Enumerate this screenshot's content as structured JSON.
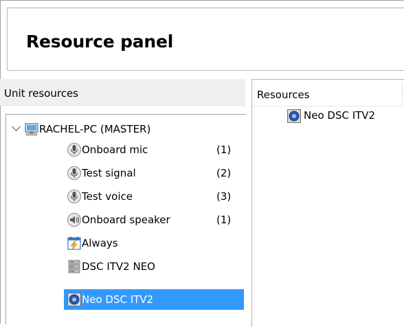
{
  "panel": {
    "title": "Resource panel"
  },
  "unit_resources": {
    "header": "Unit resources",
    "root": {
      "label": "RACHEL-PC (MASTER)",
      "expanded": true
    },
    "items": [
      {
        "label": "Onboard mic",
        "count": "(1)",
        "icon": "microphone-icon"
      },
      {
        "label": "Test signal",
        "count": "(2)",
        "icon": "microphone-icon"
      },
      {
        "label": "Test voice",
        "count": "(3)",
        "icon": "microphone-icon"
      },
      {
        "label": "Onboard speaker",
        "count": "(1)",
        "icon": "speaker-icon"
      },
      {
        "label": "Always",
        "count": "",
        "icon": "calendar-lightning-icon"
      },
      {
        "label": "DSC  ITV2 NEO",
        "count": "",
        "icon": "server-icon"
      },
      {
        "label": "Neo DSC ITV2",
        "count": "",
        "icon": "gear-icon",
        "selected": true
      }
    ]
  },
  "resources": {
    "header": "Resources",
    "items": [
      {
        "label": "Neo DSC ITV2",
        "icon": "gear-icon"
      }
    ]
  },
  "colors": {
    "selection": "#3399ff",
    "header_bg": "#f0f0f0"
  }
}
